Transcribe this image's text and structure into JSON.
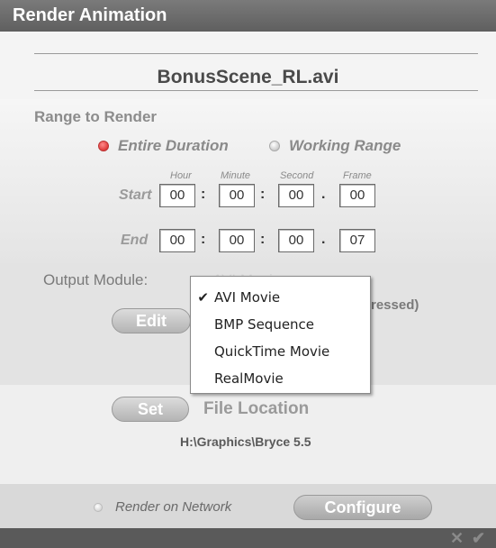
{
  "window": {
    "title": "Render Animation"
  },
  "file": {
    "name": "BonusScene_RL.avi"
  },
  "range": {
    "section_label": "Range to Render",
    "options": [
      {
        "label": "Entire Duration",
        "selected": true
      },
      {
        "label": "Working Range",
        "selected": false
      }
    ],
    "columns": [
      "Hour",
      "Minute",
      "Second",
      "Frame"
    ],
    "start": {
      "label": "Start",
      "values": [
        "00",
        "00",
        "00",
        "00"
      ]
    },
    "end": {
      "label": "End",
      "values": [
        "00",
        "00",
        "00",
        "07"
      ]
    },
    "separators": [
      ":",
      ":",
      "."
    ]
  },
  "output": {
    "label": "Output Module:",
    "current_value_obscured": "AVI Movie",
    "edit_label": "Edit",
    "compression_note": "ressed)",
    "menu": [
      {
        "label": "AVI Movie",
        "checked": true,
        "check_glyph": "✔"
      },
      {
        "label": "BMP Sequence",
        "checked": false,
        "check_glyph": ""
      },
      {
        "label": "QuickTime Movie",
        "checked": false,
        "check_glyph": ""
      },
      {
        "label": "RealMovie",
        "checked": false,
        "check_glyph": ""
      }
    ]
  },
  "location": {
    "set_label": "Set",
    "file_location_label": "File Location",
    "path": "H:\\Graphics\\Bryce 5.5"
  },
  "network": {
    "label": "Render on Network",
    "selected": false,
    "configure_label": "Configure"
  },
  "footer": {
    "cancel_icon": "x-icon",
    "confirm_icon": "checkmark-icon",
    "cancel_glyph": "✕",
    "confirm_glyph": "✔"
  },
  "colors": {
    "radio_selected": "#d11a1a",
    "titlebar": "#6a6a6a"
  }
}
